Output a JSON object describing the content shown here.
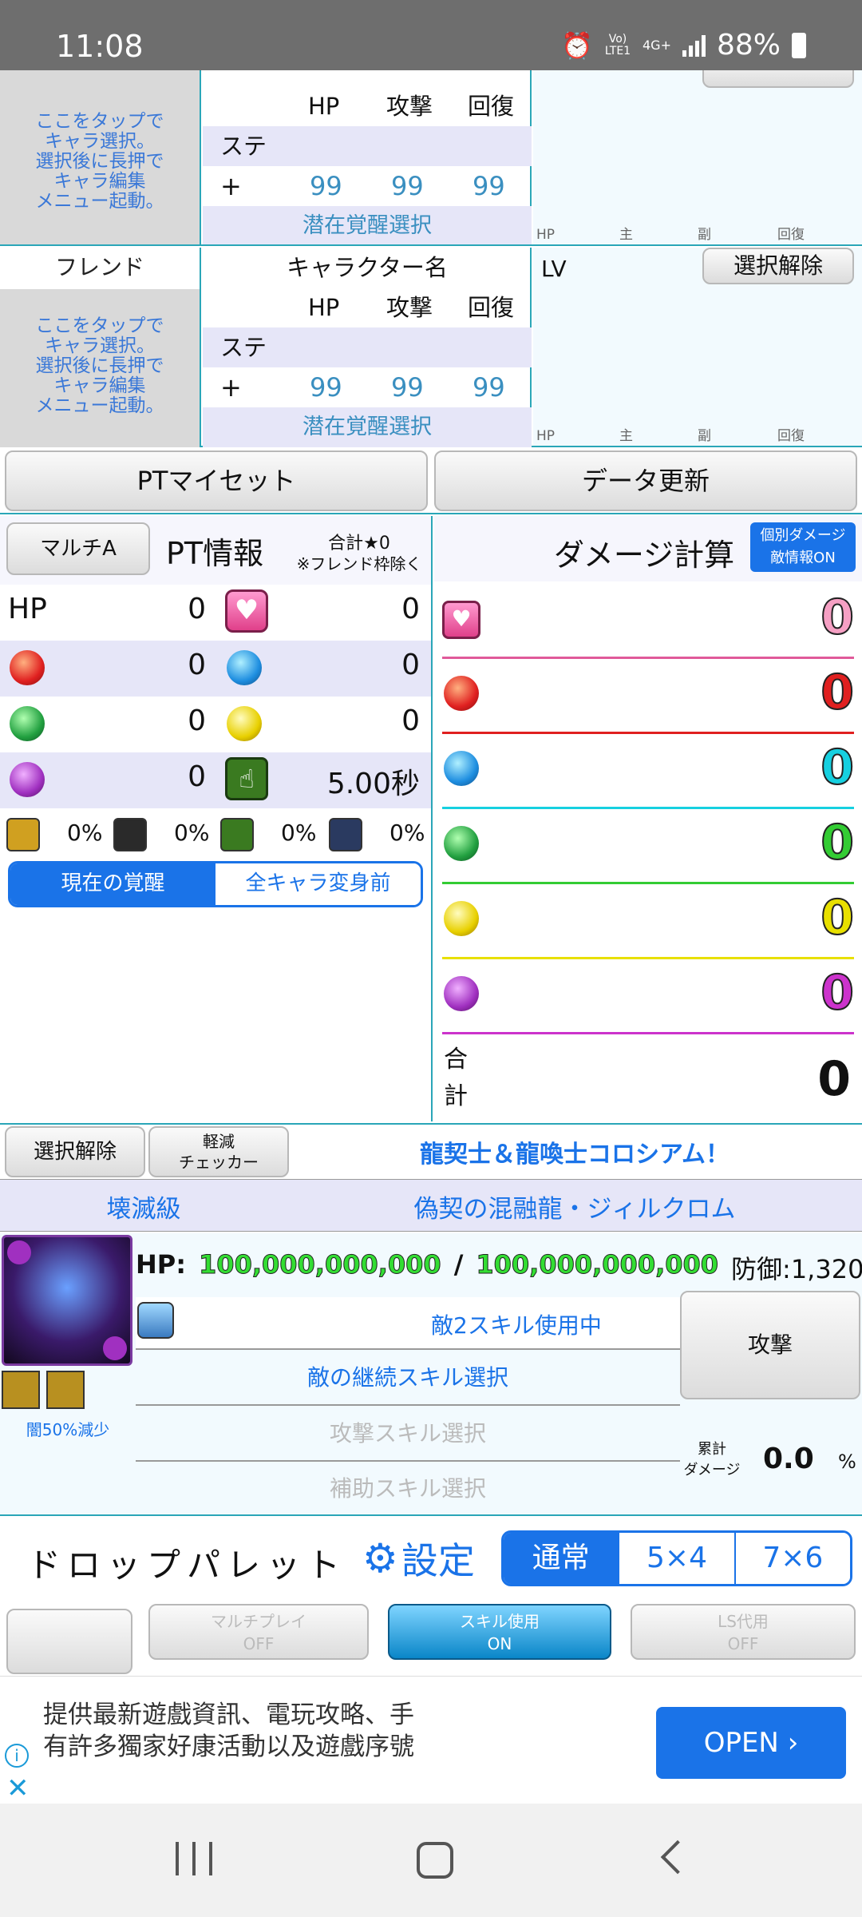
{
  "status": {
    "time": "11:08",
    "volte": "Vo) LTE1",
    "net": "4G+",
    "battery": "88%"
  },
  "row1": {
    "hp": "HP",
    "atk": "攻撃",
    "rcv": "回復",
    "ste": "ステ",
    "plus": "+",
    "v1": "99",
    "v2": "99",
    "v3": "99",
    "latent": "潜在覚醒選択",
    "hint": [
      "ここをタップで",
      "キャラ選択。",
      "選択後に長押で",
      "キャラ編集",
      "メニュー起動。"
    ],
    "rlabels": [
      "HP",
      "主",
      "副",
      "回復"
    ]
  },
  "friend": {
    "label": "フレンド",
    "name": "キャラクター名",
    "hp": "HP",
    "atk": "攻撃",
    "rcv": "回復",
    "ste": "ステ",
    "plus": "+",
    "v1": "99",
    "v2": "99",
    "v3": "99",
    "latent": "潜在覚醒選択",
    "lv": "LV",
    "deselect": "選択解除",
    "hint": [
      "ここをタップで",
      "キャラ選択。",
      "選択後に長押で",
      "キャラ編集",
      "メニュー起動。"
    ],
    "rlabels": [
      "HP",
      "主",
      "副",
      "回復"
    ]
  },
  "buttons": {
    "myset": "PTマイセット",
    "update": "データ更新"
  },
  "pt": {
    "multi": "マルチA",
    "title": "PT情報",
    "total": "合計★0",
    "note": "※フレンド枠除く",
    "hp_label": "HP",
    "hp": "0",
    "heart": "0",
    "fire": "0",
    "water": "0",
    "wood": "0",
    "light": "0",
    "dark": "0",
    "time": "5.00秒",
    "res": [
      "0%",
      "0%",
      "0%",
      "0%"
    ],
    "tab_current": "現在の覚醒",
    "tab_before": "全キャラ変身前"
  },
  "dmg": {
    "title": "ダメージ計算",
    "badge1": "個別ダメージ",
    "badge2": "敵情報ON",
    "values": [
      "0",
      "0",
      "0",
      "0",
      "0",
      "0"
    ],
    "total_label1": "合",
    "total_label2": "計",
    "total": "0"
  },
  "enemy": {
    "deselect": "選択解除",
    "checker1": "軽減",
    "checker2": "チェッカー",
    "dungeon": "龍契士＆龍喚士コロシアム！",
    "difficulty": "壊滅級",
    "name": "偽契の混融龍・ジィルクロム",
    "hp_label": "HP:",
    "hp_cur": "100,000,000,000",
    "slash": "/",
    "hp_max": "100,000,000,000",
    "defense": "防御:1,320",
    "skill_status": "敵2スキル使用中",
    "cont_skill": "敵の継続スキル選択",
    "atk_skill": "攻撃スキル選択",
    "sup_skill": "補助スキル選択",
    "attack": "攻撃",
    "cum1": "累計",
    "cum2": "ダメージ",
    "cum_val": "0.0",
    "pct": "%",
    "reduction": "闇50%減少"
  },
  "palette": {
    "title": "ドロップパレット",
    "settings": "設定",
    "modes": [
      "通常",
      "5×4",
      "7×6"
    ],
    "multi1": "マルチプレイ",
    "multi2": "OFF",
    "skill1": "スキル使用",
    "skill2": "ON",
    "ls1": "LS代用",
    "ls2": "OFF"
  },
  "ad": {
    "line1": "提供最新遊戲資訊、電玩攻略、手",
    "line2": "有許多獨家好康活動以及遊戲序號",
    "open": "OPEN"
  },
  "colors": {
    "teal": "#2aa6b8",
    "blue": "#1a73e8",
    "heart": "#e05a9a",
    "fire": "#e02020",
    "water": "#16d0e0",
    "wood": "#33cc33",
    "light": "#e8e000",
    "dark": "#cc33cc"
  }
}
